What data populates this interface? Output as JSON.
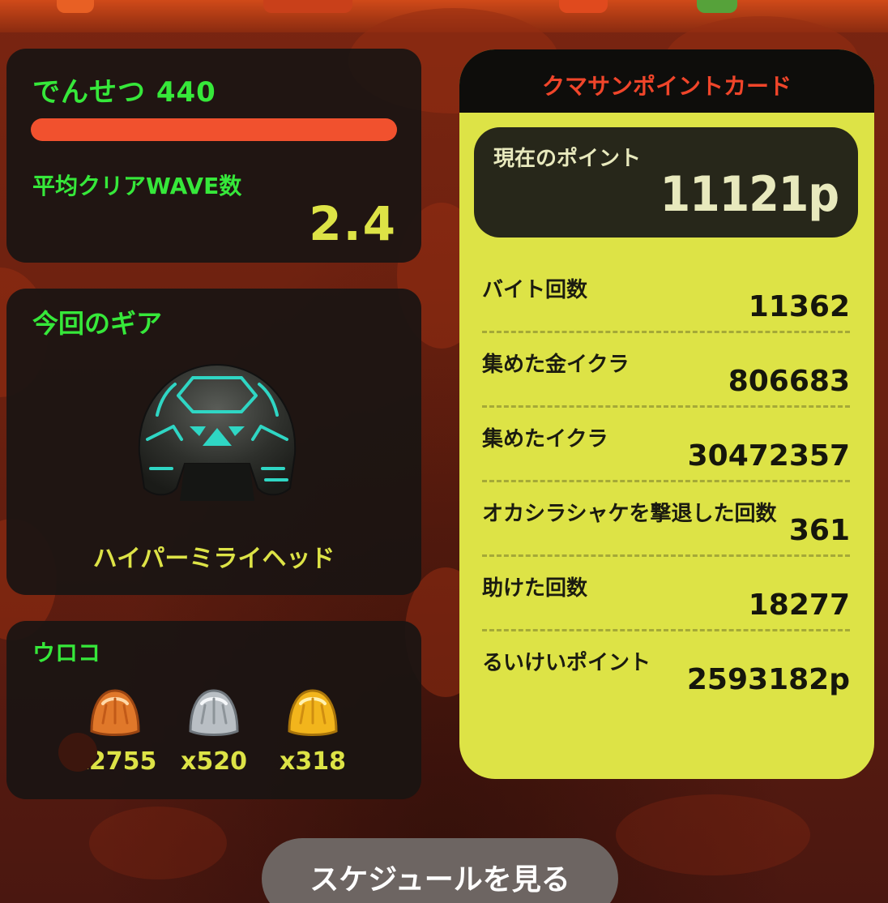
{
  "rank": {
    "title": "でんせつ 440",
    "progress": 1.0,
    "avg_wave_label": "平均クリアWAVE数",
    "avg_wave_value": "2.4"
  },
  "gear": {
    "title": "今回のギア",
    "item_name": "ハイパーミライヘッド",
    "icon": "helmet-icon"
  },
  "scales": {
    "title": "ウロコ",
    "items": [
      {
        "icon": "bronze-scale-icon",
        "count": "x2755",
        "color": "#e0782a"
      },
      {
        "icon": "silver-scale-icon",
        "count": "x520",
        "color": "#b9bfc4"
      },
      {
        "icon": "gold-scale-icon",
        "count": "x318",
        "color": "#f2b51c"
      }
    ]
  },
  "point_card": {
    "title": "クマサンポイントカード",
    "current_label": "現在のポイント",
    "current_value": "11121p",
    "stats": [
      {
        "label": "バイト回数",
        "value": "11362"
      },
      {
        "label": "集めた金イクラ",
        "value": "806683"
      },
      {
        "label": "集めたイクラ",
        "value": "30472357"
      },
      {
        "label": "オカシラシャケを撃退した回数",
        "value": "361"
      },
      {
        "label": "助けた回数",
        "value": "18277"
      },
      {
        "label": "るいけいポイント",
        "value": "2593182p"
      }
    ]
  },
  "schedule_button": "スケジュールを見る",
  "colors": {
    "accent_green": "#36e83a",
    "accent_yellow": "#dde346",
    "rank_bar": "#f1512e",
    "card_title": "#f0452a"
  }
}
